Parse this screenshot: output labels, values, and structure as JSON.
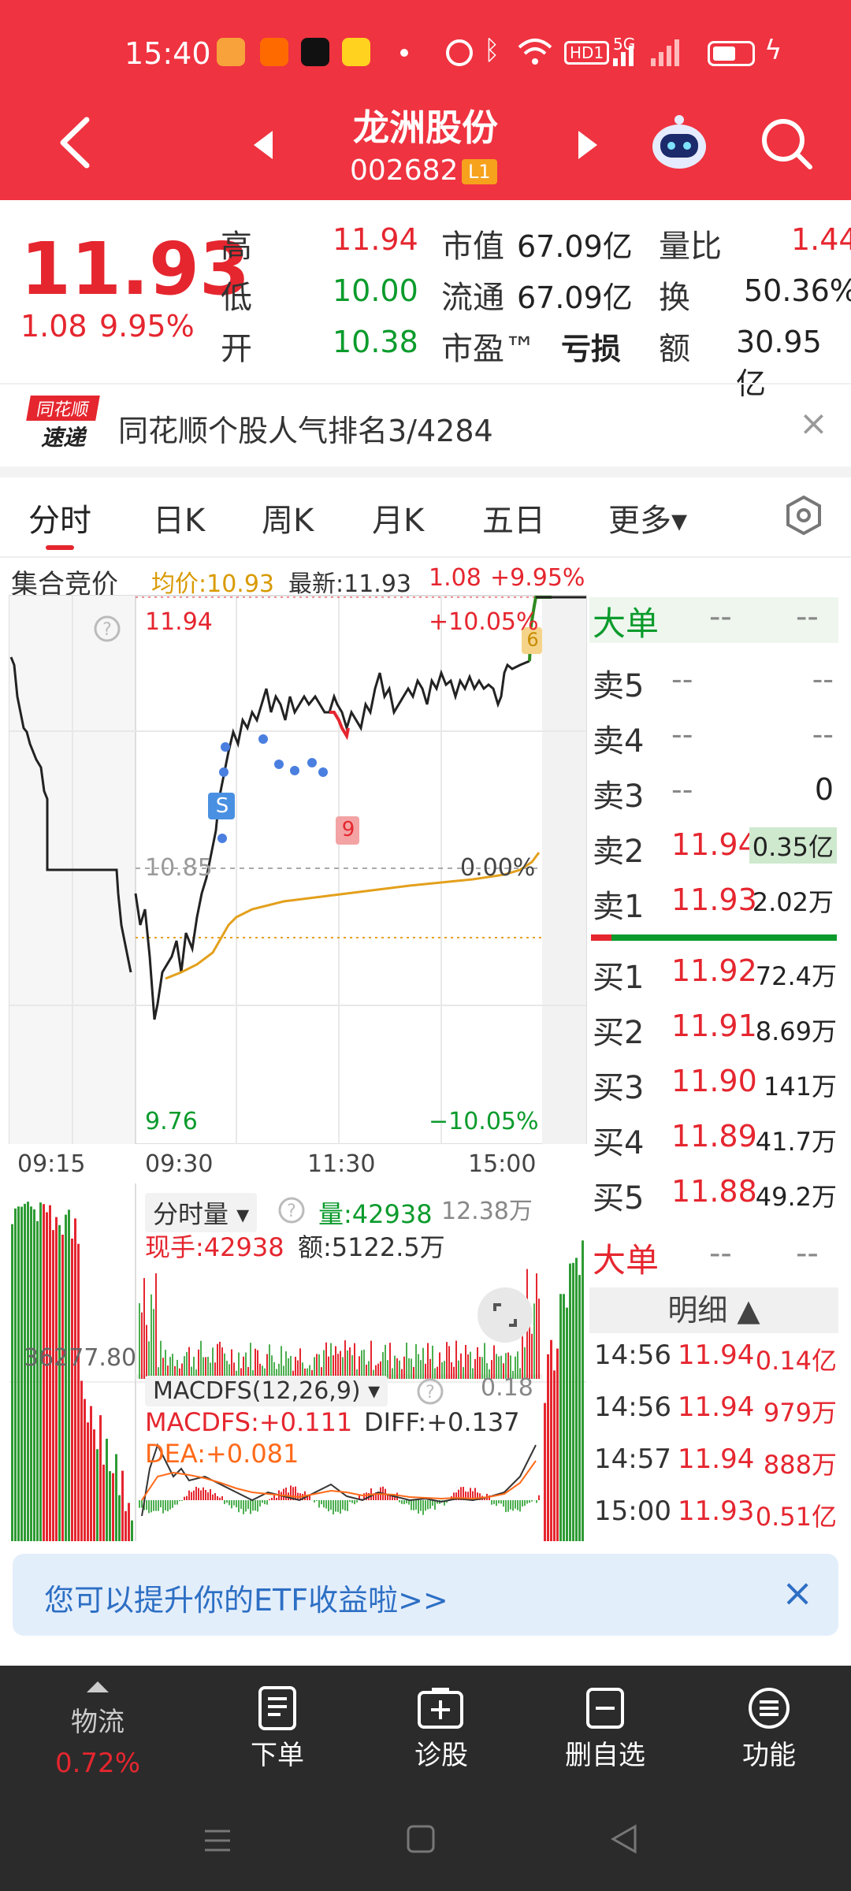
{
  "status": {
    "time": "15:40",
    "hd": "HD1",
    "net": "5G"
  },
  "header": {
    "name": "龙洲股份",
    "code": "002682",
    "level": "L1"
  },
  "quote": {
    "price": "11.93",
    "change": "1.08",
    "change_pct": "9.95%",
    "high_label": "高",
    "high": "11.94",
    "low_label": "低",
    "low": "10.00",
    "open_label": "开",
    "open": "10.38",
    "mcap_label": "市值",
    "mcap": "67.09亿",
    "float_label": "流通",
    "float": "67.09亿",
    "pe_label": "市盈™",
    "pe": "亏损",
    "vr_label": "量比",
    "vr": "1.44",
    "turn_label": "换",
    "turn": "50.36%",
    "amt_label": "额",
    "amt": "30.95亿"
  },
  "banner": {
    "logo_top": "同花顺",
    "logo_bottom": "速递",
    "text": "同花顺个股人气排名3/4284"
  },
  "tabs": [
    "分时",
    "日K",
    "周K",
    "月K",
    "五日",
    "更多▾"
  ],
  "chart_info": {
    "auction": "集合竞价",
    "avg": "均价:10.93",
    "latest": "最新:11.93",
    "chg": "1.08",
    "pct": "+9.95%"
  },
  "chart": {
    "high": "11.94",
    "high_pct": "+10.05%",
    "mid": "10.85",
    "mid_pct": "0.00%",
    "low": "9.76",
    "low_pct": "−10.05%",
    "times": [
      "09:15",
      "09:30",
      "11:30",
      "15:00"
    ],
    "marker_s": "S",
    "marker_9": "9",
    "marker_6": "6"
  },
  "vol": {
    "title": "分时量 ▾",
    "amount": "量:42938",
    "max": "12.38万",
    "hand": "现手:42938",
    "money": "额:5122.5万",
    "left_val": "36277.80"
  },
  "macd": {
    "title": "MACDFS(12,26,9) ▾",
    "max": "0.18",
    "macd": "MACDFS:+0.111",
    "diff": "DIFF:+0.137",
    "dea": "DEA:+0.081"
  },
  "orderbook": {
    "big_label": "大单",
    "dash": "--",
    "asks": [
      {
        "label": "卖5",
        "price": "--",
        "vol": "--"
      },
      {
        "label": "卖4",
        "price": "--",
        "vol": "--"
      },
      {
        "label": "卖3",
        "price": "--",
        "vol": "0"
      },
      {
        "label": "卖2",
        "price": "11.94",
        "vol": "0.35亿"
      },
      {
        "label": "卖1",
        "price": "11.93",
        "vol": "2.02万"
      }
    ],
    "bids": [
      {
        "label": "买1",
        "price": "11.92",
        "vol": "72.4万"
      },
      {
        "label": "买2",
        "price": "11.91",
        "vol": "8.69万"
      },
      {
        "label": "买3",
        "price": "11.90",
        "vol": "141万"
      },
      {
        "label": "买4",
        "price": "11.89",
        "vol": "41.7万"
      },
      {
        "label": "买5",
        "price": "11.88",
        "vol": "49.2万"
      }
    ],
    "detail_label": "明细 ▲",
    "ticks": [
      {
        "time": "14:56",
        "price": "11.94",
        "vol": "0.14亿"
      },
      {
        "time": "14:56",
        "price": "11.94",
        "vol": "979万"
      },
      {
        "time": "14:57",
        "price": "11.94",
        "vol": "888万"
      },
      {
        "time": "15:00",
        "price": "11.93",
        "vol": "0.51亿"
      }
    ]
  },
  "etf_banner": "您可以提升你的ETF收益啦>>",
  "bottom": {
    "sector": "物流",
    "sector_pct": "0.72%",
    "order": "下单",
    "diag": "诊股",
    "del": "删自选",
    "func": "功能"
  }
}
